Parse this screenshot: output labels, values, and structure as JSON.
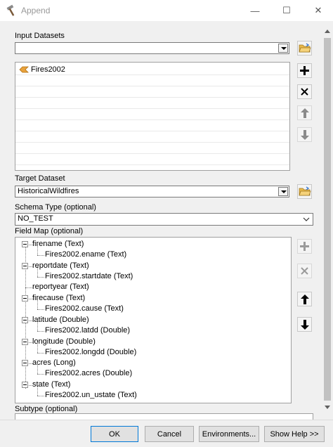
{
  "window": {
    "title": "Append",
    "minimize": "—",
    "maximize": "☐",
    "close": "✕"
  },
  "input_datasets": {
    "label": "Input Datasets",
    "value": "",
    "items": [
      "Fires2002"
    ]
  },
  "target_dataset": {
    "label": "Target Dataset",
    "value": "HistoricalWildfires"
  },
  "schema_type": {
    "label": "Schema Type (optional)",
    "value": "NO_TEST"
  },
  "field_map": {
    "label": "Field Map (optional)",
    "rows": [
      {
        "text": "firename (Text)",
        "level": 0,
        "expandable": true
      },
      {
        "text": "Fires2002.ename (Text)",
        "level": 1
      },
      {
        "text": "reportdate (Text)",
        "level": 0,
        "expandable": true
      },
      {
        "text": "Fires2002.startdate (Text)",
        "level": 1
      },
      {
        "text": "reportyear (Text)",
        "level": 0
      },
      {
        "text": "firecause (Text)",
        "level": 0,
        "expandable": true
      },
      {
        "text": "Fires2002.cause (Text)",
        "level": 1
      },
      {
        "text": "latitude (Double)",
        "level": 0,
        "expandable": true
      },
      {
        "text": "Fires2002.latdd (Double)",
        "level": 1
      },
      {
        "text": "longitude (Double)",
        "level": 0,
        "expandable": true
      },
      {
        "text": "Fires2002.longdd (Double)",
        "level": 1
      },
      {
        "text": "acres (Long)",
        "level": 0,
        "expandable": true
      },
      {
        "text": "Fires2002.acres (Double)",
        "level": 1
      },
      {
        "text": "state (Text)",
        "level": 0,
        "expandable": true
      },
      {
        "text": "Fires2002.un_ustate (Text)",
        "level": 1
      }
    ]
  },
  "subtype": {
    "label": "Subtype (optional)"
  },
  "buttons": {
    "ok": "OK",
    "cancel": "Cancel",
    "environments": "Environments...",
    "show_help": "Show Help >>"
  },
  "icons": {
    "folder": "open-folder-icon",
    "add": "plus-icon",
    "remove": "x-icon",
    "up": "arrow-up-icon",
    "down": "arrow-down-icon",
    "dataset": "feature-class-icon"
  },
  "colors": {
    "accent": "#0078d7",
    "folder": "#e8b84a",
    "feature": "#e9a23b"
  }
}
